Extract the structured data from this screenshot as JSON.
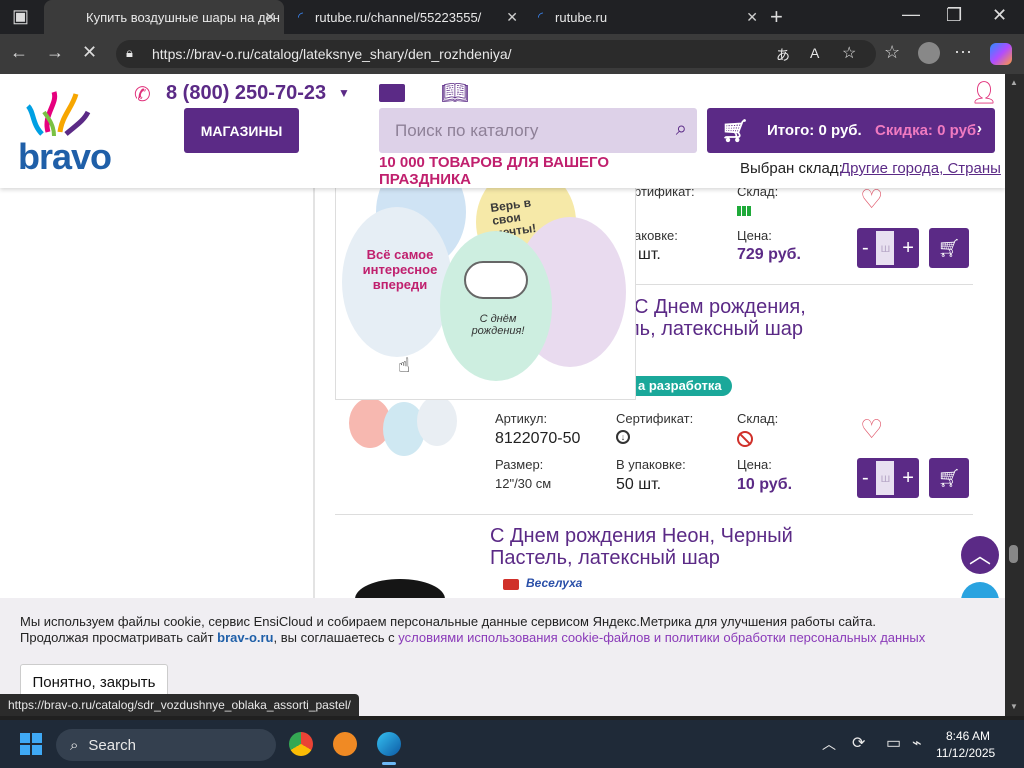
{
  "browser": {
    "tabs": [
      {
        "title": "Купить воздушные шары на ден",
        "active": true
      },
      {
        "title": "rutube.ru/channel/55223555/",
        "active": false
      },
      {
        "title": "rutube.ru",
        "active": false
      }
    ],
    "url": "https://brav-o.ru/catalog/lateksnye_shary/den_rozhdeniya/",
    "status_url": "https://brav-o.ru/catalog/sdr_vozdushnye_oblaka_assorti_pastel/"
  },
  "header": {
    "logo_text": "bravo",
    "phone": "8 (800) 250-70-23",
    "stores_label": "МАГАЗИНЫ",
    "search_placeholder": "Поиск по каталогу",
    "cart_total": "Итого: 0 руб.",
    "cart_discount": "Скидка: 0 руб.",
    "promo": "10 000 ТОВАРОВ ДЛЯ ВАШЕГО ПРАЗДНИКА",
    "warehouse_label": "Выбран склад:",
    "warehouse_value": "Другие города, Страны"
  },
  "products": [
    {
      "cert_label": "ртификат:",
      "stock_label": "Склад:",
      "pack_label": "аковке:",
      "pack_value": "шт.",
      "price_label": "Цена:",
      "price": "729 руб.",
      "qty_placeholder": "ш"
    },
    {
      "title_line1": "С Днем рождения,",
      "title_line2": "ль, латексный шар",
      "badge": "а разработка",
      "article_label": "Артикул:",
      "article": "8122070-50",
      "cert_label": "Сертификат:",
      "stock_label": "Склад:",
      "size_label": "Размер:",
      "size": "12\"/30 см",
      "pack_label": "В упаковке:",
      "pack_value": "50 шт.",
      "price_label": "Цена:",
      "price": "10 руб.",
      "qty_placeholder": "ш"
    },
    {
      "title_line1": "С Днем рождения Неон, Черный",
      "title_line2": "Пастель, латексный шар",
      "brand": "Веселуха"
    }
  ],
  "preview_balloons": [
    "Всё самое интересное впереди",
    "С днём рождения!",
    "Верь в свои мечты!"
  ],
  "cookie": {
    "line1": "Мы используем файлы cookie, сервис EnsiCloud и собираем персональные данные сервисом Яндекс.Метрика для улучшения работы сайта.",
    "line2_prefix": "Продолжая просматривать сайт",
    "line2_brand": "brav-o.ru",
    "line2_mid": ", вы соглашаетесь с",
    "line2_link": "условиями использования cookie-файлов и политики обработки персональных данных",
    "ok_label": "Понятно, закрыть"
  },
  "taskbar": {
    "search_label": "Search",
    "time": "8:46 AM",
    "date": "11/12/2025"
  },
  "colors": {
    "brand_purple": "#5b2a86",
    "search_bg": "#ddd1e8",
    "heart": "#e0576a",
    "badge_teal": "#1aa89a"
  }
}
